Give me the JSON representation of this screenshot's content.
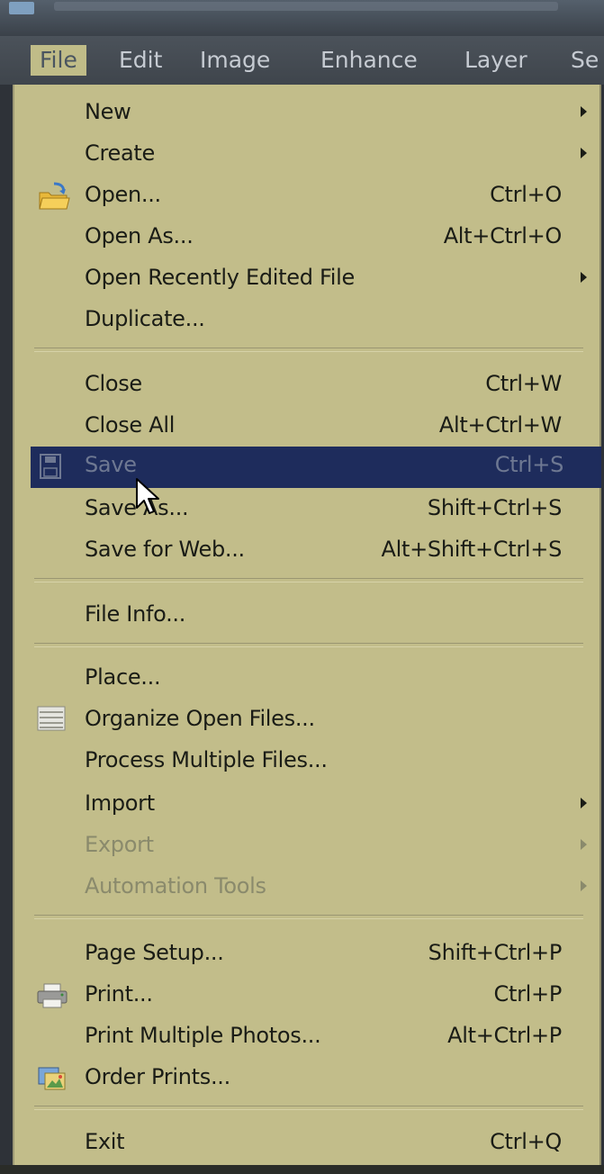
{
  "menubar": {
    "items": [
      "File",
      "Edit",
      "Image",
      "Enhance",
      "Layer",
      "Se"
    ]
  },
  "file_menu": {
    "items": [
      {
        "label": "New",
        "shortcut": "",
        "submenu": true
      },
      {
        "label": "Create",
        "shortcut": "",
        "submenu": true
      },
      {
        "label": "Open...",
        "shortcut": "Ctrl+O",
        "icon": "open-folder-icon"
      },
      {
        "label": "Open As...",
        "shortcut": "Alt+Ctrl+O"
      },
      {
        "label": "Open Recently Edited File",
        "shortcut": "",
        "submenu": true
      },
      {
        "label": "Duplicate...",
        "shortcut": ""
      },
      {
        "label": "Close",
        "shortcut": "Ctrl+W"
      },
      {
        "label": "Close All",
        "shortcut": "Alt+Ctrl+W"
      },
      {
        "label": "Save",
        "shortcut": "Ctrl+S",
        "icon": "save-icon",
        "highlighted": true
      },
      {
        "label": "Save As...",
        "shortcut": "Shift+Ctrl+S"
      },
      {
        "label": "Save for Web...",
        "shortcut": "Alt+Shift+Ctrl+S"
      },
      {
        "label": "File Info...",
        "shortcut": ""
      },
      {
        "label": "Place...",
        "shortcut": ""
      },
      {
        "label": "Organize Open Files...",
        "shortcut": "",
        "icon": "organize-files-icon"
      },
      {
        "label": "Process Multiple Files...",
        "shortcut": ""
      },
      {
        "label": "Import",
        "shortcut": "",
        "submenu": true
      },
      {
        "label": "Export",
        "shortcut": "",
        "submenu": true,
        "disabled": true
      },
      {
        "label": "Automation Tools",
        "shortcut": "",
        "submenu": true,
        "disabled": true
      },
      {
        "label": "Page Setup...",
        "shortcut": "Shift+Ctrl+P"
      },
      {
        "label": "Print...",
        "shortcut": "Ctrl+P",
        "icon": "printer-icon"
      },
      {
        "label": "Print Multiple Photos...",
        "shortcut": "Alt+Ctrl+P"
      },
      {
        "label": "Order Prints...",
        "shortcut": "",
        "icon": "order-prints-icon"
      },
      {
        "label": "Exit",
        "shortcut": "Ctrl+Q"
      }
    ]
  },
  "colors": {
    "menu_background": "#c2bd8a",
    "highlight": "#1e2c5c",
    "menubar": "#434950"
  }
}
